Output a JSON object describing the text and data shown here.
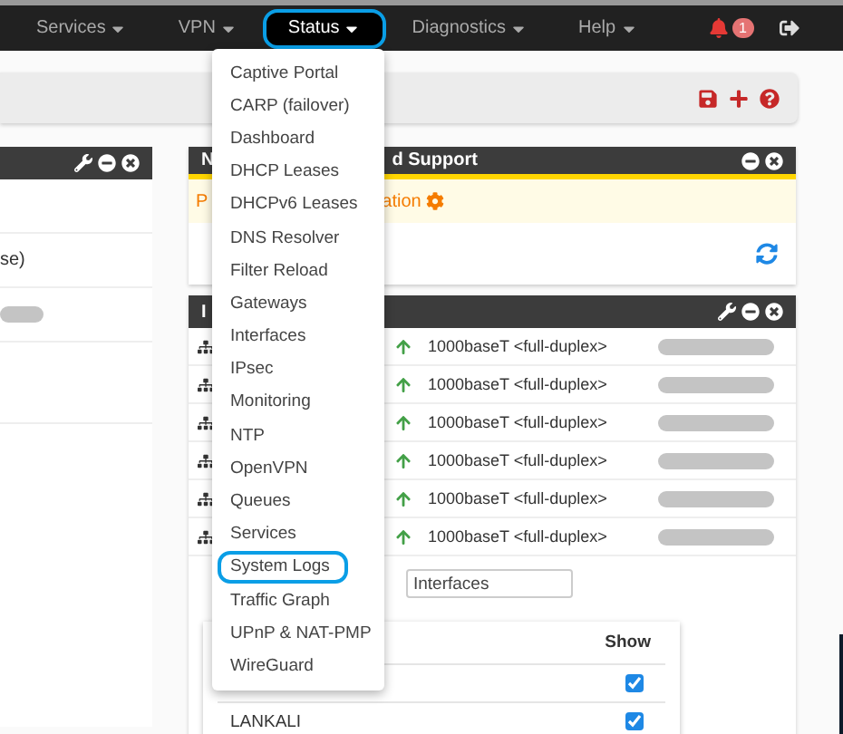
{
  "navbar": {
    "items": [
      {
        "label": "Services",
        "selected": false,
        "highlighted": false
      },
      {
        "label": "VPN",
        "selected": false,
        "highlighted": false
      },
      {
        "label": "Status",
        "selected": true,
        "highlighted": true
      },
      {
        "label": "Diagnostics",
        "selected": false,
        "highlighted": false
      },
      {
        "label": "Help",
        "selected": false,
        "highlighted": false
      }
    ],
    "notification_count": "1"
  },
  "status_menu": {
    "items": [
      {
        "label": "Captive Portal",
        "highlighted": false
      },
      {
        "label": "CARP (failover)",
        "highlighted": false
      },
      {
        "label": "Dashboard",
        "highlighted": false
      },
      {
        "label": "DHCP Leases",
        "highlighted": false
      },
      {
        "label": "DHCPv6 Leases",
        "highlighted": false
      },
      {
        "label": "DNS Resolver",
        "highlighted": false
      },
      {
        "label": "Filter Reload",
        "highlighted": false
      },
      {
        "label": "Gateways",
        "highlighted": false
      },
      {
        "label": "Interfaces",
        "highlighted": false
      },
      {
        "label": "IPsec",
        "highlighted": false
      },
      {
        "label": "Monitoring",
        "highlighted": false
      },
      {
        "label": "NTP",
        "highlighted": false
      },
      {
        "label": "OpenVPN",
        "highlighted": false
      },
      {
        "label": "Queues",
        "highlighted": false
      },
      {
        "label": "Services",
        "highlighted": false
      },
      {
        "label": "System Logs",
        "highlighted": true
      },
      {
        "label": "Traffic Graph",
        "highlighted": false
      },
      {
        "label": "UPnP & NAT-PMP",
        "highlighted": false
      },
      {
        "label": "WireGuard",
        "highlighted": false
      }
    ]
  },
  "left_panel": {
    "row_text": "se)"
  },
  "support_panel": {
    "title_start": "N",
    "title_end": "d Support",
    "notice_start": "P",
    "notice_end": "ation"
  },
  "interfaces_panel": {
    "title": "I",
    "rows": [
      {
        "link_up": true,
        "speed": "1000baseT <full-duplex>"
      },
      {
        "link_up": true,
        "speed": "1000baseT <full-duplex>"
      },
      {
        "link_up": true,
        "speed": "1000baseT <full-duplex>"
      },
      {
        "link_up": true,
        "speed": "1000baseT <full-duplex>"
      },
      {
        "link_up": true,
        "speed": "1000baseT <full-duplex>"
      },
      {
        "link_up": true,
        "speed": "1000baseT <full-duplex>"
      }
    ],
    "filter_value": "Interfaces",
    "show_header": "Show",
    "show_rows": [
      {
        "checked": true
      },
      {
        "name": "LANKALI",
        "checked": true
      }
    ]
  }
}
